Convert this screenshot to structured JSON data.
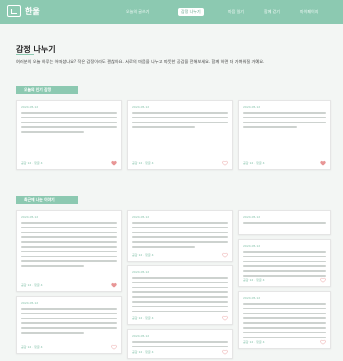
{
  "brand": {
    "name": "한울"
  },
  "nav": {
    "items": [
      "오늘의 글쓰기",
      "감정 나누기",
      "마음 일기",
      "함께 걷기",
      "마이페이지"
    ],
    "active": 1
  },
  "page": {
    "title": "감정 나누기",
    "intro": "여러분의 오늘 하루는 어떠셨나요? 작은 감정이라도 괜찮아요. 서로의 마음을 나누고 따뜻한 공감을 전해보세요. 함께 하면 더 가벼워질 거예요."
  },
  "sections": {
    "popular": "오늘의 인기 감정",
    "recent": "최근에 나눈 이야기"
  },
  "card_meta": {
    "date": "2024.05.12",
    "likes": "공감 12 · 댓글 4"
  },
  "colors": {
    "accent": "#8cc9b1",
    "heart": "#e89696"
  }
}
